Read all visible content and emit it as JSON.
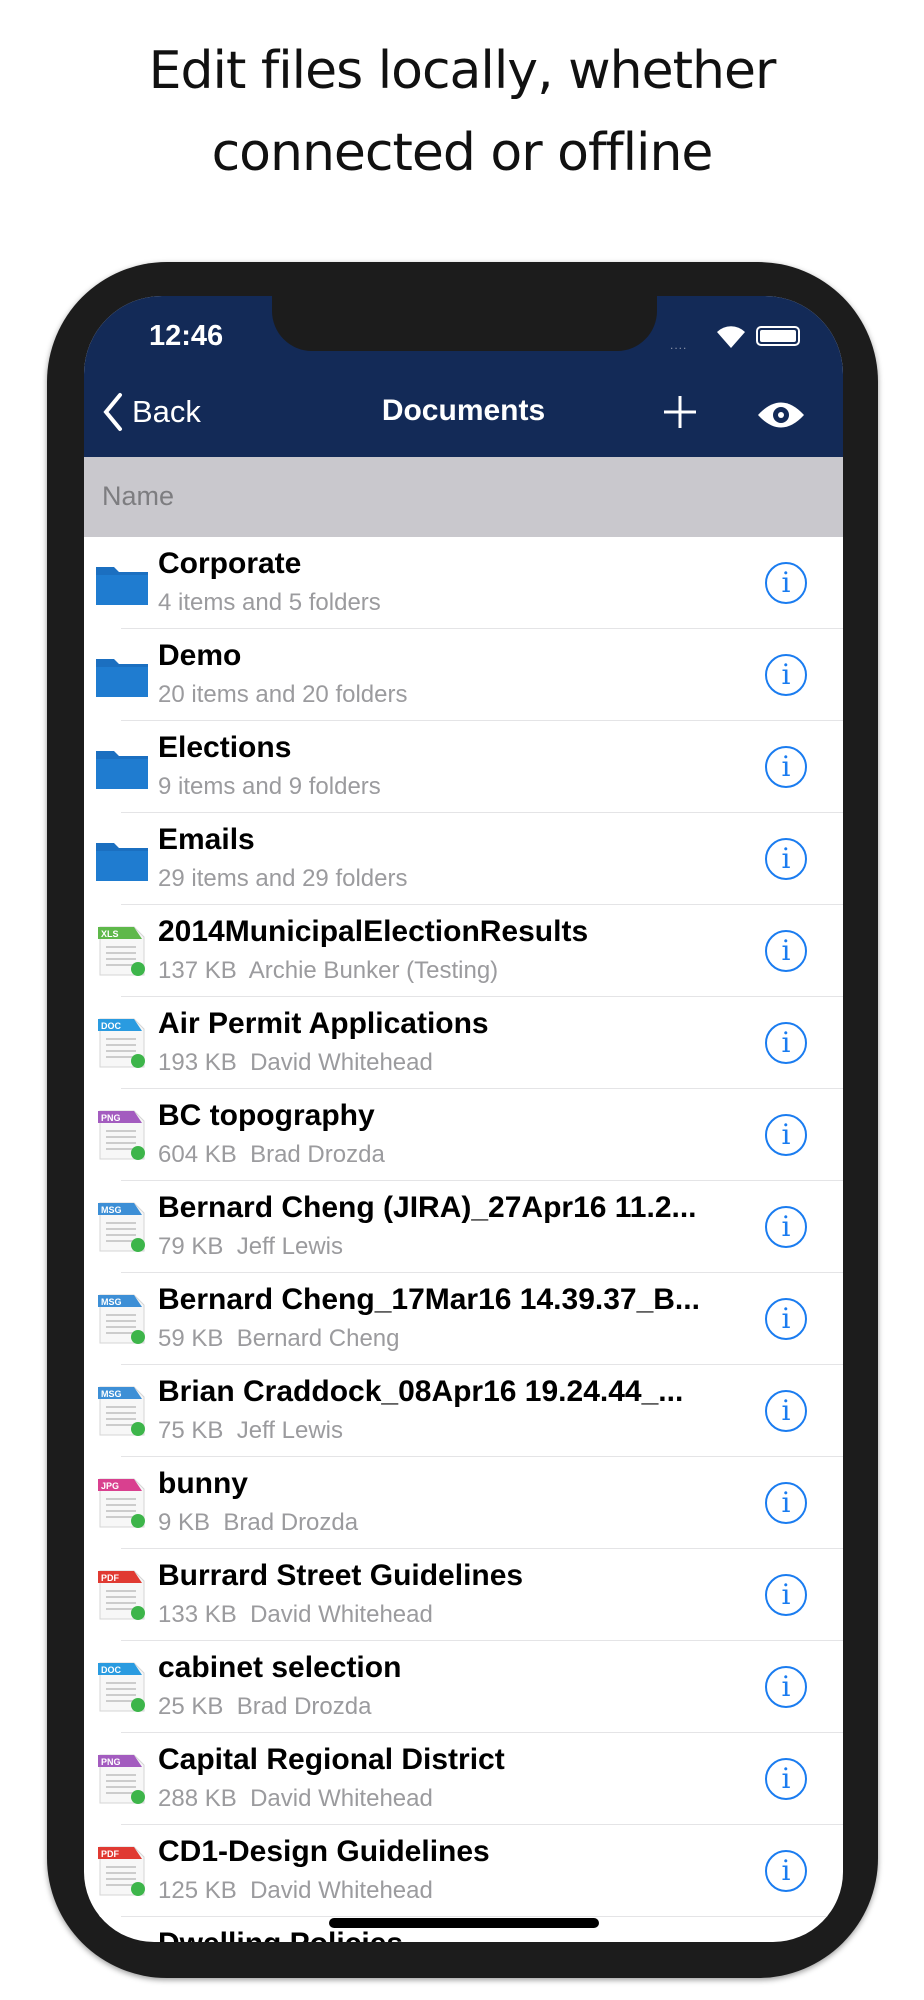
{
  "headline": [
    "Edit files locally, whether",
    "connected or offline"
  ],
  "status": {
    "time": "12:46",
    "signal": "....",
    "colors": {
      "nav": "#132a57",
      "accent": "#1a7cf0",
      "synced": "#3db54a"
    }
  },
  "nav": {
    "back": "Back",
    "title": "Documents",
    "add_icon": "plus-icon",
    "view_icon": "eye-icon"
  },
  "header": {
    "name": "Name"
  },
  "items": [
    {
      "type": "folder",
      "name": "Corporate",
      "sub": "4 items and 5 folders"
    },
    {
      "type": "folder",
      "name": "Demo",
      "sub": "20 items and 20 folders"
    },
    {
      "type": "folder",
      "name": "Elections",
      "sub": "9 items and 9 folders"
    },
    {
      "type": "folder",
      "name": "Emails",
      "sub": "29 items and 29 folders"
    },
    {
      "type": "XLS",
      "name": "2014MunicipalElectionResults",
      "sub": "137 KB  Archie Bunker (Testing)"
    },
    {
      "type": "DOC",
      "name": "Air Permit Applications",
      "sub": "193 KB  David Whitehead"
    },
    {
      "type": "PNG",
      "name": "BC topography",
      "sub": "604 KB  Brad Drozda"
    },
    {
      "type": "MSG",
      "name": "Bernard Cheng (JIRA)_27Apr16 11.2...",
      "sub": "79 KB  Jeff Lewis"
    },
    {
      "type": "MSG",
      "name": "Bernard Cheng_17Mar16 14.39.37_B...",
      "sub": "59 KB  Bernard Cheng"
    },
    {
      "type": "MSG",
      "name": "Brian Craddock_08Apr16 19.24.44_...",
      "sub": "75 KB  Jeff Lewis"
    },
    {
      "type": "JPG",
      "name": "bunny",
      "sub": "9 KB  Brad Drozda"
    },
    {
      "type": "PDF",
      "name": "Burrard Street Guidelines",
      "sub": "133 KB  David Whitehead"
    },
    {
      "type": "DOC",
      "name": "cabinet selection",
      "sub": "25 KB  Brad Drozda"
    },
    {
      "type": "PNG",
      "name": "Capital Regional District",
      "sub": "288 KB  David Whitehead"
    },
    {
      "type": "PDF",
      "name": "CD1-Design Guidelines",
      "sub": "125 KB  David Whitehead"
    },
    {
      "type": "file",
      "name": "Dwelling Policies",
      "sub": ""
    }
  ],
  "tag_colors": {
    "XLS": "#5eb84a",
    "DOC": "#2a9be0",
    "PNG": "#a35cbf",
    "MSG": "#3d8fd6",
    "JPG": "#d9408f",
    "PDF": "#e03a32"
  }
}
